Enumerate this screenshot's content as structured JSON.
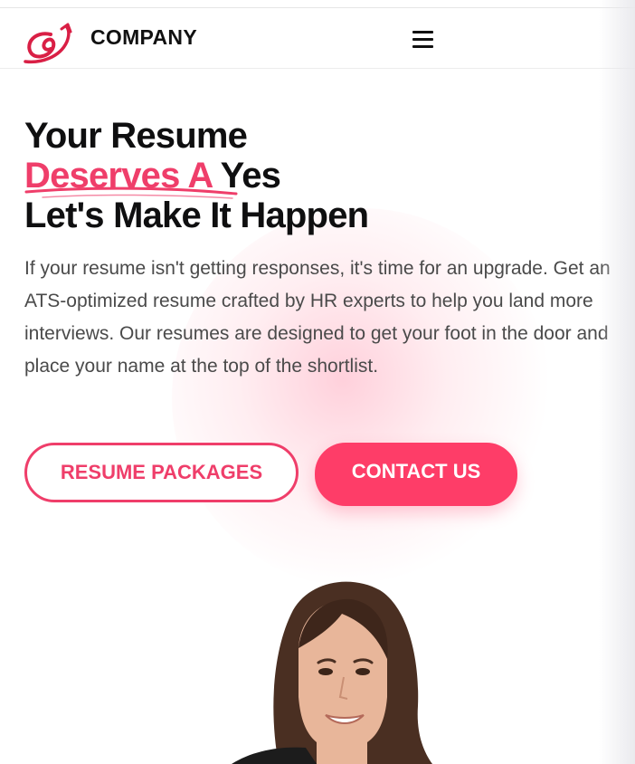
{
  "header": {
    "brand": "COMPANY",
    "logo_icon": "swirl-arrow-logo-icon",
    "menu_icon": "hamburger-menu-icon"
  },
  "hero": {
    "title_line1": "Your Resume",
    "title_accent": "Deserves A",
    "title_line2_rest": "Yes",
    "title_line3": "Let's Make It Happen",
    "description": "If your resume isn't getting responses, it's time for an upgrade. Get an ATS-optimized resume crafted by HR experts to help you land more interviews. Our resumes are designed to get your foot in the door and place your name at the top of the shortlist."
  },
  "buttons": {
    "packages": "RESUME PACKAGES",
    "contact": "CONTACT US"
  },
  "colors": {
    "accent": "#ef3e6a",
    "button_fill": "#fe3d68",
    "text_dark": "#0f0f10",
    "text_body": "#4a4a4a"
  }
}
